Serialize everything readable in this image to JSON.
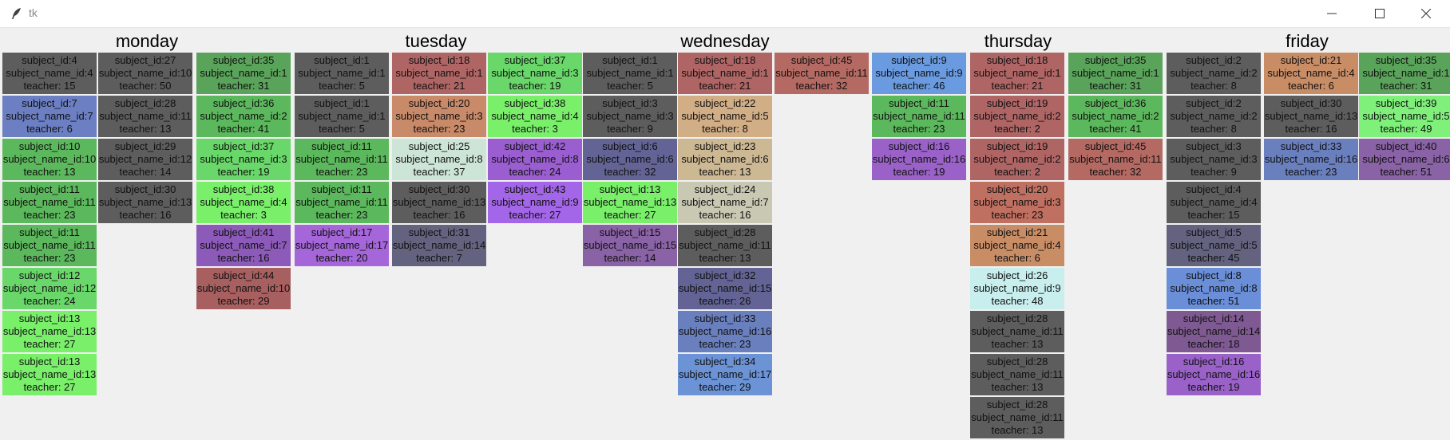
{
  "window": {
    "title": "tk"
  },
  "days": [
    {
      "name": "monday",
      "columns": [
        [
          {
            "subject_id": "subject_id:4",
            "subject_name": "subject_name_id:4",
            "teacher": "teacher: 15",
            "color": "#5d5d5d"
          },
          {
            "subject_id": "subject_id:7",
            "subject_name": "subject_name_id:7",
            "teacher": "teacher: 6",
            "color": "#6b7fc2"
          },
          {
            "subject_id": "subject_id:10",
            "subject_name": "subject_name_id:10",
            "teacher": "teacher: 13",
            "color": "#5cb85c"
          },
          {
            "subject_id": "subject_id:11",
            "subject_name": "subject_name_id:11",
            "teacher": "teacher: 23",
            "color": "#5cb85c"
          },
          {
            "subject_id": "subject_id:11",
            "subject_name": "subject_name_id:11",
            "teacher": "teacher: 23",
            "color": "#5cb85c"
          },
          {
            "subject_id": "subject_id:12",
            "subject_name": "subject_name_id:12",
            "teacher": "teacher: 24",
            "color": "#69d769"
          },
          {
            "subject_id": "subject_id:13",
            "subject_name": "subject_name_id:13",
            "teacher": "teacher: 27",
            "color": "#79ef6a"
          },
          {
            "subject_id": "subject_id:13",
            "subject_name": "subject_name_id:13",
            "teacher": "teacher: 27",
            "color": "#79ef6a"
          }
        ],
        [
          {
            "subject_id": "subject_id:27",
            "subject_name": "subject_name_id:10",
            "teacher": "teacher: 50",
            "color": "#5d5d5d"
          },
          {
            "subject_id": "subject_id:28",
            "subject_name": "subject_name_id:11",
            "teacher": "teacher: 13",
            "color": "#5d5d5d"
          },
          {
            "subject_id": "subject_id:29",
            "subject_name": "subject_name_id:12",
            "teacher": "teacher: 14",
            "color": "#5d5d5d"
          },
          {
            "subject_id": "subject_id:30",
            "subject_name": "subject_name_id:13",
            "teacher": "teacher: 16",
            "color": "#5d5d5d"
          }
        ],
        [
          {
            "subject_id": "subject_id:35",
            "subject_name": "subject_name_id:1",
            "teacher": "teacher: 31",
            "color": "#5aa35a"
          },
          {
            "subject_id": "subject_id:36",
            "subject_name": "subject_name_id:2",
            "teacher": "teacher: 41",
            "color": "#5cb85c"
          },
          {
            "subject_id": "subject_id:37",
            "subject_name": "subject_name_id:3",
            "teacher": "teacher: 19",
            "color": "#69d769"
          },
          {
            "subject_id": "subject_id:38",
            "subject_name": "subject_name_id:4",
            "teacher": "teacher: 3",
            "color": "#79ef6a"
          },
          {
            "subject_id": "subject_id:41",
            "subject_name": "subject_name_id:7",
            "teacher": "teacher: 16",
            "color": "#8c5ab8"
          },
          {
            "subject_id": "subject_id:44",
            "subject_name": "subject_name_id:10",
            "teacher": "teacher: 29",
            "color": "#a85f5f"
          }
        ]
      ]
    },
    {
      "name": "tuesday",
      "columns": [
        [
          {
            "subject_id": "subject_id:1",
            "subject_name": "subject_name_id:1",
            "teacher": "teacher: 5",
            "color": "#5d5d5d"
          },
          {
            "subject_id": "subject_id:1",
            "subject_name": "subject_name_id:1",
            "teacher": "teacher: 5",
            "color": "#5d5d5d"
          },
          {
            "subject_id": "subject_id:11",
            "subject_name": "subject_name_id:11",
            "teacher": "teacher: 23",
            "color": "#5cb85c"
          },
          {
            "subject_id": "subject_id:11",
            "subject_name": "subject_name_id:11",
            "teacher": "teacher: 23",
            "color": "#5cb85c"
          },
          {
            "subject_id": "subject_id:17",
            "subject_name": "subject_name_id:17",
            "teacher": "teacher: 20",
            "color": "#a466d9"
          }
        ],
        [
          {
            "subject_id": "subject_id:18",
            "subject_name": "subject_name_id:1",
            "teacher": "teacher: 21",
            "color": "#b06565"
          },
          {
            "subject_id": "subject_id:20",
            "subject_name": "subject_name_id:3",
            "teacher": "teacher: 23",
            "color": "#c98a6a"
          },
          {
            "subject_id": "subject_id:25",
            "subject_name": "subject_name_id:8",
            "teacher": "teacher: 37",
            "color": "#cde5d6"
          },
          {
            "subject_id": "subject_id:30",
            "subject_name": "subject_name_id:13",
            "teacher": "teacher: 16",
            "color": "#5d5d5d"
          },
          {
            "subject_id": "subject_id:31",
            "subject_name": "subject_name_id:14",
            "teacher": "teacher: 7",
            "color": "#636380"
          }
        ],
        [
          {
            "subject_id": "subject_id:37",
            "subject_name": "subject_name_id:3",
            "teacher": "teacher: 19",
            "color": "#69d769"
          },
          {
            "subject_id": "subject_id:38",
            "subject_name": "subject_name_id:4",
            "teacher": "teacher: 3",
            "color": "#79ef6a"
          },
          {
            "subject_id": "subject_id:42",
            "subject_name": "subject_name_id:8",
            "teacher": "teacher: 24",
            "color": "#9a5ed0"
          },
          {
            "subject_id": "subject_id:43",
            "subject_name": "subject_name_id:9",
            "teacher": "teacher: 27",
            "color": "#a466e8"
          }
        ]
      ]
    },
    {
      "name": "wednesday",
      "columns": [
        [
          {
            "subject_id": "subject_id:1",
            "subject_name": "subject_name_id:1",
            "teacher": "teacher: 5",
            "color": "#5d5d5d"
          },
          {
            "subject_id": "subject_id:3",
            "subject_name": "subject_name_id:3",
            "teacher": "teacher: 9",
            "color": "#5d5d5d"
          },
          {
            "subject_id": "subject_id:6",
            "subject_name": "subject_name_id:6",
            "teacher": "teacher: 32",
            "color": "#636395"
          },
          {
            "subject_id": "subject_id:13",
            "subject_name": "subject_name_id:13",
            "teacher": "teacher: 27",
            "color": "#79ef6a"
          },
          {
            "subject_id": "subject_id:15",
            "subject_name": "subject_name_id:15",
            "teacher": "teacher: 14",
            "color": "#8a62a6"
          }
        ],
        [
          {
            "subject_id": "subject_id:18",
            "subject_name": "subject_name_id:1",
            "teacher": "teacher: 21",
            "color": "#b06565"
          },
          {
            "subject_id": "subject_id:22",
            "subject_name": "subject_name_id:5",
            "teacher": "teacher: 8",
            "color": "#d2ae86"
          },
          {
            "subject_id": "subject_id:23",
            "subject_name": "subject_name_id:6",
            "teacher": "teacher: 13",
            "color": "#cdb894"
          },
          {
            "subject_id": "subject_id:24",
            "subject_name": "subject_name_id:7",
            "teacher": "teacher: 16",
            "color": "#c9c9b3"
          },
          {
            "subject_id": "subject_id:28",
            "subject_name": "subject_name_id:11",
            "teacher": "teacher: 13",
            "color": "#5d5d5d"
          },
          {
            "subject_id": "subject_id:32",
            "subject_name": "subject_name_id:15",
            "teacher": "teacher: 26",
            "color": "#636395"
          },
          {
            "subject_id": "subject_id:33",
            "subject_name": "subject_name_id:16",
            "teacher": "teacher: 23",
            "color": "#6a7fbe"
          },
          {
            "subject_id": "subject_id:34",
            "subject_name": "subject_name_id:17",
            "teacher": "teacher: 29",
            "color": "#6b93d6"
          }
        ],
        [
          {
            "subject_id": "subject_id:45",
            "subject_name": "subject_name_id:11",
            "teacher": "teacher: 32",
            "color": "#b46a62"
          }
        ],
        [
          {
            "subject_id": "subject_id:9",
            "subject_name": "subject_name_id:9",
            "teacher": "teacher: 46",
            "color": "#6a9be0"
          },
          {
            "subject_id": "subject_id:11",
            "subject_name": "subject_name_id:11",
            "teacher": "teacher: 23",
            "color": "#5cb85c"
          },
          {
            "subject_id": "subject_id:16",
            "subject_name": "subject_name_id:16",
            "teacher": "teacher: 19",
            "color": "#9a62c8"
          }
        ]
      ]
    },
    {
      "name": "thursday",
      "columns": [
        [
          {
            "subject_id": "subject_id:18",
            "subject_name": "subject_name_id:1",
            "teacher": "teacher: 21",
            "color": "#b06565"
          },
          {
            "subject_id": "subject_id:19",
            "subject_name": "subject_name_id:2",
            "teacher": "teacher: 2",
            "color": "#b06565"
          },
          {
            "subject_id": "subject_id:19",
            "subject_name": "subject_name_id:2",
            "teacher": "teacher: 2",
            "color": "#b06565"
          },
          {
            "subject_id": "subject_id:20",
            "subject_name": "subject_name_id:3",
            "teacher": "teacher: 23",
            "color": "#c07060"
          },
          {
            "subject_id": "subject_id:21",
            "subject_name": "subject_name_id:4",
            "teacher": "teacher: 6",
            "color": "#c98d66"
          },
          {
            "subject_id": "subject_id:26",
            "subject_name": "subject_name_id:9",
            "teacher": "teacher: 48",
            "color": "#c8eeee"
          },
          {
            "subject_id": "subject_id:28",
            "subject_name": "subject_name_id:11",
            "teacher": "teacher: 13",
            "color": "#5d5d5d"
          },
          {
            "subject_id": "subject_id:28",
            "subject_name": "subject_name_id:11",
            "teacher": "teacher: 13",
            "color": "#5d5d5d"
          },
          {
            "subject_id": "subject_id:28",
            "subject_name": "subject_name_id:11",
            "teacher": "teacher: 13",
            "color": "#5d5d5d"
          }
        ],
        [
          {
            "subject_id": "subject_id:35",
            "subject_name": "subject_name_id:1",
            "teacher": "teacher: 31",
            "color": "#5aa35a"
          },
          {
            "subject_id": "subject_id:36",
            "subject_name": "subject_name_id:2",
            "teacher": "teacher: 41",
            "color": "#5cb85c"
          },
          {
            "subject_id": "subject_id:45",
            "subject_name": "subject_name_id:11",
            "teacher": "teacher: 32",
            "color": "#b46a62"
          }
        ],
        [
          {
            "subject_id": "subject_id:2",
            "subject_name": "subject_name_id:2",
            "teacher": "teacher: 8",
            "color": "#5d5d5d"
          },
          {
            "subject_id": "subject_id:2",
            "subject_name": "subject_name_id:2",
            "teacher": "teacher: 8",
            "color": "#5d5d5d"
          },
          {
            "subject_id": "subject_id:3",
            "subject_name": "subject_name_id:3",
            "teacher": "teacher: 9",
            "color": "#5d5d5d"
          },
          {
            "subject_id": "subject_id:4",
            "subject_name": "subject_name_id:4",
            "teacher": "teacher: 15",
            "color": "#5d5d5d"
          },
          {
            "subject_id": "subject_id:5",
            "subject_name": "subject_name_id:5",
            "teacher": "teacher: 45",
            "color": "#636380"
          },
          {
            "subject_id": "subject_id:8",
            "subject_name": "subject_name_id:8",
            "teacher": "teacher: 51",
            "color": "#6a8fd8"
          },
          {
            "subject_id": "subject_id:14",
            "subject_name": "subject_name_id:14",
            "teacher": "teacher: 18",
            "color": "#7f5a92"
          },
          {
            "subject_id": "subject_id:16",
            "subject_name": "subject_name_id:16",
            "teacher": "teacher: 19",
            "color": "#9a62c8"
          }
        ]
      ]
    },
    {
      "name": "friday",
      "columns": [
        [
          {
            "subject_id": "subject_id:21",
            "subject_name": "subject_name_id:4",
            "teacher": "teacher: 6",
            "color": "#c98d66"
          },
          {
            "subject_id": "subject_id:30",
            "subject_name": "subject_name_id:13",
            "teacher": "teacher: 16",
            "color": "#5d5d5d"
          },
          {
            "subject_id": "subject_id:33",
            "subject_name": "subject_name_id:16",
            "teacher": "teacher: 23",
            "color": "#6a7fbe"
          }
        ],
        [
          {
            "subject_id": "subject_id:35",
            "subject_name": "subject_name_id:1",
            "teacher": "teacher: 31",
            "color": "#5aa35a"
          },
          {
            "subject_id": "subject_id:39",
            "subject_name": "subject_name_id:5",
            "teacher": "teacher: 49",
            "color": "#7ff07a"
          },
          {
            "subject_id": "subject_id:40",
            "subject_name": "subject_name_id:6",
            "teacher": "teacher: 51",
            "color": "#8a62a6"
          }
        ]
      ]
    }
  ]
}
